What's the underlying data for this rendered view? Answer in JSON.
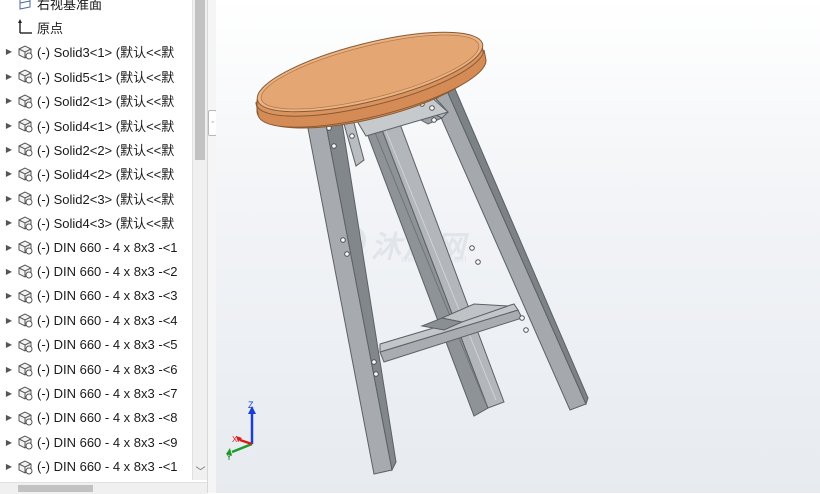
{
  "feature_tree": {
    "items": [
      {
        "label": "右视基准面",
        "icon": "plane-icon",
        "expandable": false
      },
      {
        "label": "原点",
        "icon": "origin-icon",
        "expandable": false
      },
      {
        "label": "(-) Solid3<1> (默认<<默",
        "icon": "part-icon",
        "expandable": true
      },
      {
        "label": "(-) Solid5<1> (默认<<默",
        "icon": "part-icon",
        "expandable": true
      },
      {
        "label": "(-) Solid2<1> (默认<<默",
        "icon": "part-icon",
        "expandable": true
      },
      {
        "label": "(-) Solid4<1> (默认<<默",
        "icon": "part-icon",
        "expandable": true
      },
      {
        "label": "(-) Solid2<2> (默认<<默",
        "icon": "part-icon",
        "expandable": true
      },
      {
        "label": "(-) Solid4<2> (默认<<默",
        "icon": "part-icon",
        "expandable": true
      },
      {
        "label": "(-) Solid2<3> (默认<<默",
        "icon": "part-icon",
        "expandable": true
      },
      {
        "label": "(-) Solid4<3> (默认<<默",
        "icon": "part-icon",
        "expandable": true
      },
      {
        "label": "(-) DIN 660 - 4 x 8x3 -<1",
        "icon": "part-icon",
        "expandable": true
      },
      {
        "label": "(-) DIN 660 - 4 x 8x3 -<2",
        "icon": "part-icon",
        "expandable": true
      },
      {
        "label": "(-) DIN 660 - 4 x 8x3 -<3",
        "icon": "part-icon",
        "expandable": true
      },
      {
        "label": "(-) DIN 660 - 4 x 8x3 -<4",
        "icon": "part-icon",
        "expandable": true
      },
      {
        "label": "(-) DIN 660 - 4 x 8x3 -<5",
        "icon": "part-icon",
        "expandable": true
      },
      {
        "label": "(-) DIN 660 - 4 x 8x3 -<6",
        "icon": "part-icon",
        "expandable": true
      },
      {
        "label": "(-) DIN 660 - 4 x 8x3 -<7",
        "icon": "part-icon",
        "expandable": true
      },
      {
        "label": "(-) DIN 660 - 4 x 8x3 -<8",
        "icon": "part-icon",
        "expandable": true
      },
      {
        "label": "(-) DIN 660 - 4 x 8x3 -<9",
        "icon": "part-icon",
        "expandable": true
      },
      {
        "label": "(-) DIN 660 - 4 x 8x3 -<1",
        "icon": "part-icon",
        "expandable": true
      }
    ]
  },
  "viewport": {
    "watermark": {
      "text": "沐风网",
      "url": "www.mfcad.com"
    },
    "triad": {
      "x_label": "X",
      "y_label": "Y",
      "z_label": "Z"
    },
    "colors": {
      "seat": "#e0a070",
      "legs": "#9ea3a8",
      "background": "#eef1f5"
    }
  }
}
